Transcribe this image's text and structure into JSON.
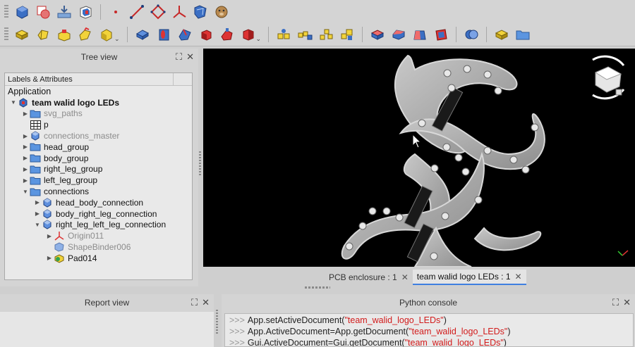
{
  "toolbar_top": {
    "icons": [
      "part-container-icon",
      "boolean-icon",
      "sketch-attach-icon",
      "part-body-icon",
      "point-icon",
      "line-icon",
      "plane-icon",
      "lcs-icon",
      "shape-binder-icon",
      "clone-icon"
    ]
  },
  "toolbar_bottom": {
    "icons": [
      "pad-icon",
      "revolution-icon",
      "additive-loft-icon",
      "additive-pipe-icon",
      "additive-helix-icon",
      "pocket-icon",
      "hole-icon",
      "groove-icon",
      "subtractive-loft-icon",
      "subtractive-pipe-icon",
      "subtractive-helix-icon",
      "mirror-icon",
      "linear-pattern-icon",
      "polar-pattern-icon",
      "multitransform-icon",
      "fillet-icon",
      "chamfer-icon",
      "draft-icon",
      "thickness-icon",
      "boolean-op-icon",
      "sprocket-icon",
      "folder-icon"
    ]
  },
  "tree_panel": {
    "title": "Tree view",
    "header": "Labels & Attributes",
    "root": "Application",
    "items": [
      {
        "label": "team walid logo LEDs",
        "level": 0,
        "expanded": true,
        "bold": true,
        "dim": false,
        "icon": "document-icon"
      },
      {
        "label": "svg_paths",
        "level": 1,
        "expanded": false,
        "bold": false,
        "dim": true,
        "icon": "folder-icon"
      },
      {
        "label": "p",
        "level": 1,
        "expanded": null,
        "bold": false,
        "dim": false,
        "icon": "spreadsheet-icon"
      },
      {
        "label": "connections_master",
        "level": 1,
        "expanded": false,
        "bold": false,
        "dim": true,
        "icon": "body-icon"
      },
      {
        "label": "head_group",
        "level": 1,
        "expanded": false,
        "bold": false,
        "dim": false,
        "icon": "folder-icon"
      },
      {
        "label": "body_group",
        "level": 1,
        "expanded": false,
        "bold": false,
        "dim": false,
        "icon": "folder-icon"
      },
      {
        "label": "right_leg_group",
        "level": 1,
        "expanded": false,
        "bold": false,
        "dim": false,
        "icon": "folder-icon"
      },
      {
        "label": "left_leg_group",
        "level": 1,
        "expanded": false,
        "bold": false,
        "dim": false,
        "icon": "folder-icon"
      },
      {
        "label": "connections",
        "level": 1,
        "expanded": true,
        "bold": false,
        "dim": false,
        "icon": "folder-icon"
      },
      {
        "label": "head_body_connection",
        "level": 2,
        "expanded": false,
        "bold": false,
        "dim": false,
        "icon": "body-icon"
      },
      {
        "label": "body_right_leg_connection",
        "level": 2,
        "expanded": false,
        "bold": false,
        "dim": false,
        "icon": "body-icon"
      },
      {
        "label": "right_leg_left_leg_connection",
        "level": 2,
        "expanded": true,
        "bold": false,
        "dim": false,
        "icon": "body-icon"
      },
      {
        "label": "Origin011",
        "level": 3,
        "expanded": false,
        "bold": false,
        "dim": true,
        "icon": "origin-icon"
      },
      {
        "label": "ShapeBinder006",
        "level": 3,
        "expanded": null,
        "bold": false,
        "dim": true,
        "icon": "shape-binder-icon"
      },
      {
        "label": "Pad014",
        "level": 3,
        "expanded": false,
        "bold": false,
        "dim": false,
        "icon": "pad-icon"
      }
    ]
  },
  "doc_tabs": [
    {
      "label": "PCB enclosure : 1",
      "active": false
    },
    {
      "label": "team walid logo LEDs : 1",
      "active": true
    }
  ],
  "report_view": {
    "title": "Report view"
  },
  "python_console": {
    "title": "Python console",
    "prompt": ">>>",
    "lines": [
      {
        "pre": "App.setActiveDocument(",
        "str": "\"team_walid_logo_LEDs\"",
        "post": ")"
      },
      {
        "pre": "App.ActiveDocument=App.getDocument(",
        "str": "\"team_walid_logo_LEDs\"",
        "post": ")"
      },
      {
        "pre": "Gui.ActiveDocument=Gui.getDocument(",
        "str": "\"team_walid_logo_LEDs\"",
        "post": ")"
      }
    ]
  },
  "colors": {
    "accent": "#3f7fe0",
    "console_string": "#d21b1b",
    "viewport_bg": "#000000",
    "model_fill": "#9a9a9a",
    "connector_fill": "#1a1a1a"
  }
}
